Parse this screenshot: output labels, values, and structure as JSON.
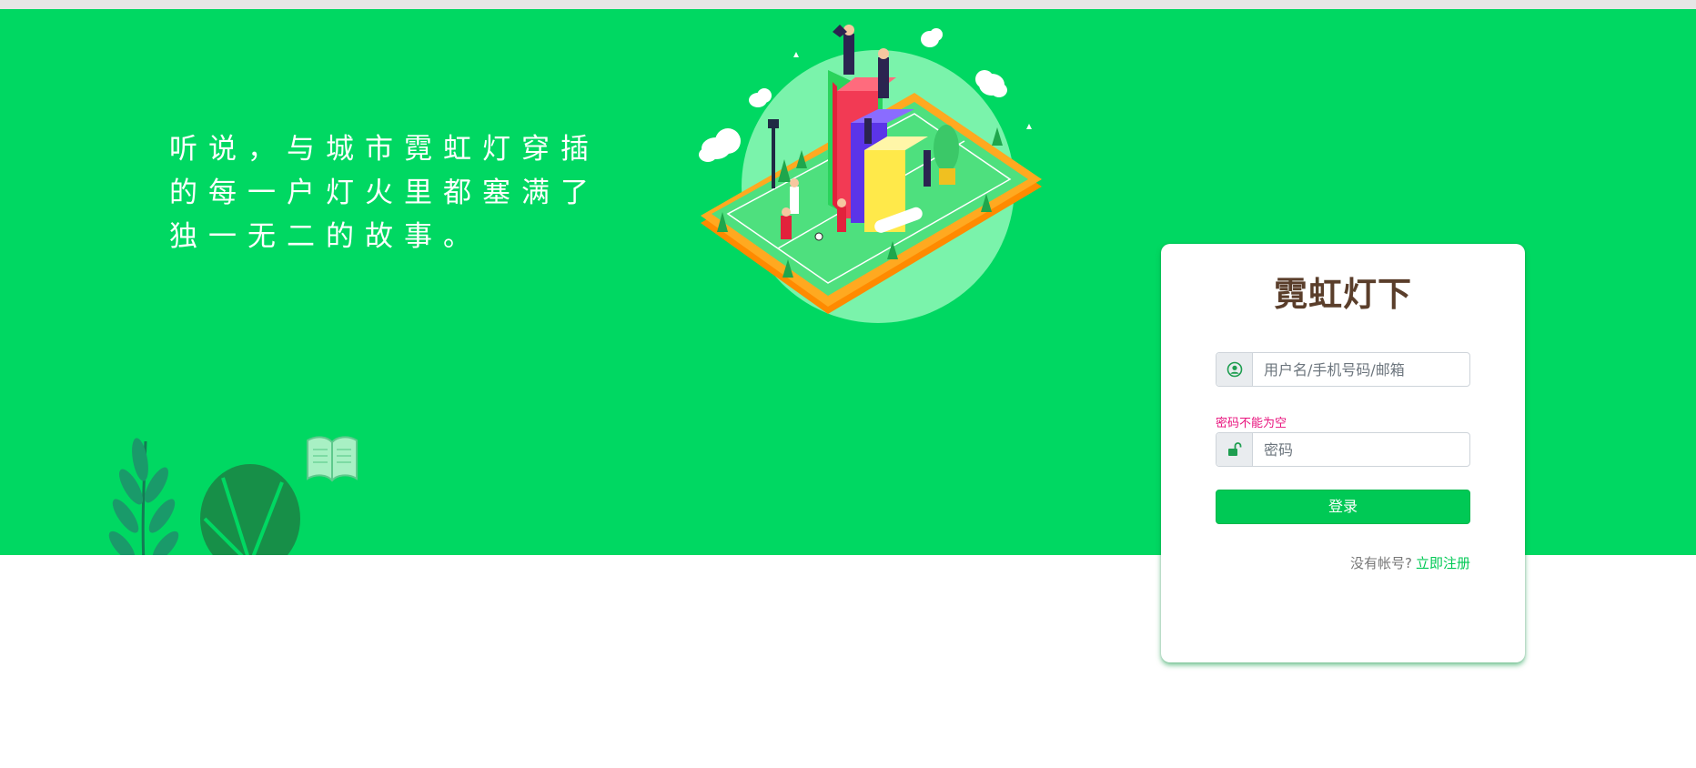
{
  "hero": {
    "slogan_lines": [
      "听说，与城市霓虹灯穿插",
      "的每一户灯火里都塞满了",
      "独一无二的故事。"
    ],
    "background_color": "#00d862"
  },
  "login_card": {
    "brand": "霓虹灯下",
    "username": {
      "placeholder": "用户名/手机号码/邮箱",
      "value": "",
      "icon": "user-circle-icon"
    },
    "password_error": "密码不能为空",
    "password": {
      "placeholder": "密码",
      "value": "",
      "icon": "unlock-icon"
    },
    "login_button": "登录",
    "no_account_text": "没有帐号?",
    "register_link": "立即注册",
    "accent_color": "#00c955",
    "error_color": "#e8137d"
  }
}
